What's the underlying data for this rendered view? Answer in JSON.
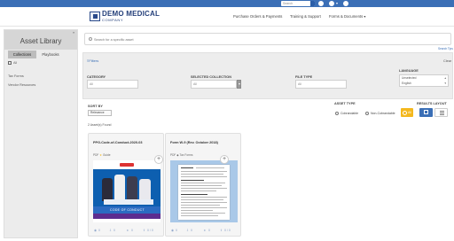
{
  "topbar": {
    "search_label": "Search",
    "user_caret": "▾"
  },
  "header": {
    "logo_title": "DEMO MEDICAL",
    "logo_subtitle": "COMPANY",
    "nav": [
      "Purchase Orders & Payments",
      "Training & Support",
      "Forms & Documents ▾"
    ]
  },
  "sidebar": {
    "title": "Asset Library",
    "collapse_glyph": "«",
    "tabs": [
      "Collections",
      "Playbooks"
    ],
    "active_tab": "Collections",
    "view_all": "All",
    "links": [
      "Tax Forms",
      "Vendor Resources"
    ]
  },
  "search": {
    "placeholder": "Search for a specific asset",
    "tips": "Search Tips"
  },
  "filters": {
    "toggle": "≡Filters",
    "clear": "Clear",
    "category_label": "CATEGORY",
    "category_value": "All",
    "collection_label": "SELECTED COLLECTION",
    "collection_value": "All",
    "filetype_label": "FILE TYPE",
    "filetype_value": "All",
    "language_label": "LANGUAGE",
    "languages": [
      "Unselected",
      "English"
    ]
  },
  "sort": {
    "label": "SORT BY",
    "value": "Relevance"
  },
  "asset_type": {
    "label": "ASSET TYPE",
    "options": [
      "Cobrandable",
      "Non-Cobrandable"
    ],
    "all_label": "All",
    "active": "All"
  },
  "results_layout": {
    "label": "RESULTS LAYOUT",
    "active": "grid"
  },
  "results": {
    "count_text": "2 Asset(s) Found",
    "cards": [
      {
        "title": "PPG-Code-of-Conduct-2020-03",
        "file_type": "PDF",
        "tag": "Guide",
        "cover_caption": "CODE OF CONDUCT",
        "views": "0",
        "downloads": "0",
        "likes": "0",
        "shares": "0 / 0"
      },
      {
        "title": "Form W-9 (Rev. October 2018)",
        "file_type": "PDF",
        "tag": "Tax Forms",
        "views": "0",
        "downloads": "0",
        "likes": "0",
        "shares": "0 / 0"
      }
    ]
  },
  "colors": {
    "topbar": "#3b6fb6",
    "brand": "#243f7a",
    "accent_all": "#f4b81e",
    "sidebar_bg": "#ececec",
    "filter_bg": "#ededed"
  },
  "icons": [
    "search-icon",
    "help-icon",
    "user-icon",
    "gear-icon",
    "plus-icon",
    "eye-icon",
    "download-icon",
    "thumbs-up-icon",
    "share-icon",
    "star-icon",
    "grid-icon",
    "list-icon"
  ]
}
